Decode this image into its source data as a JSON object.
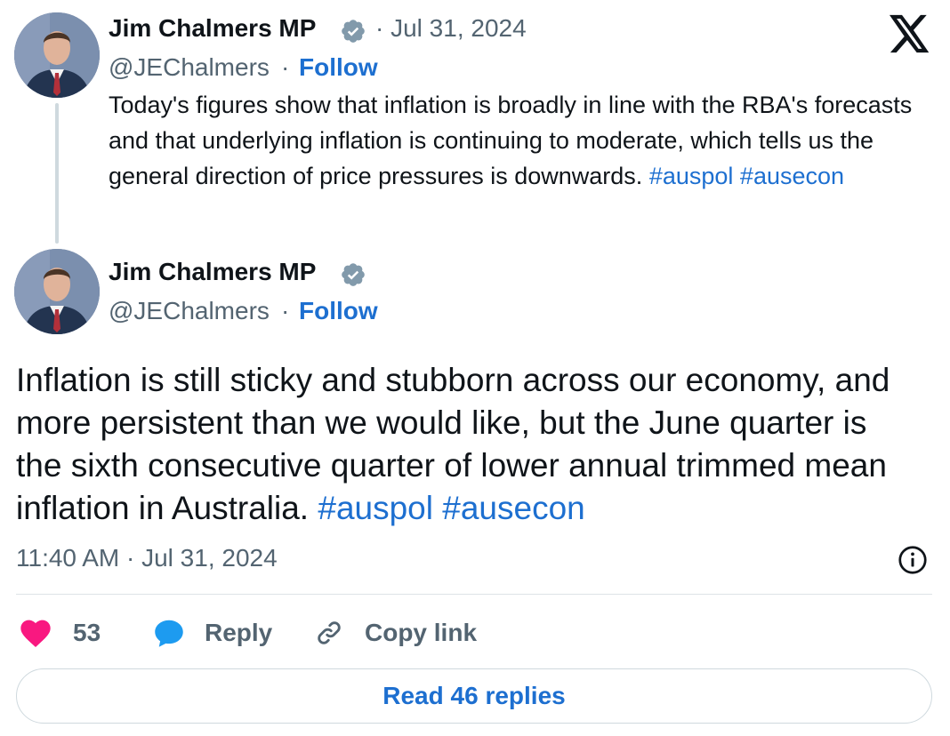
{
  "quoted_tweet": {
    "author_name": "Jim Chalmers MP",
    "date": "· Jul 31, 2024",
    "handle": "@JEChalmers",
    "separator": "·",
    "follow_label": "Follow",
    "text": "Today's figures show that inflation is broadly in line with the RBA's forecasts and that underlying inflation is continuing to moderate, which tells us the general direction of price pressures is downwards.",
    "hashtags": [
      "#auspol",
      "#ausecon"
    ]
  },
  "main_tweet": {
    "author_name": "Jim Chalmers MP",
    "handle": "@JEChalmers",
    "separator": "·",
    "follow_label": "Follow",
    "text": "Inflation is still sticky and stubborn across our economy, and more persistent than we would like, but the June quarter is the sixth consecutive quarter of lower annual trimmed mean inflation in Australia.",
    "hashtags": [
      "#auspol",
      "#ausecon"
    ],
    "timestamp": "11:40 AM · Jul 31, 2024"
  },
  "actions": {
    "like_count": "53",
    "reply_label": "Reply",
    "copy_link_label": "Copy link"
  },
  "read_replies_label": "Read 46 replies",
  "icons": {
    "platform": "x-logo-icon",
    "verified": "verified-badge-icon",
    "info": "info-icon",
    "like": "heart-icon",
    "reply": "speech-bubble-icon",
    "copy": "link-icon"
  },
  "colors": {
    "link": "#1d6fd0",
    "secondary_text": "#536471",
    "like": "#f91880",
    "reply": "#1d9bf0"
  }
}
